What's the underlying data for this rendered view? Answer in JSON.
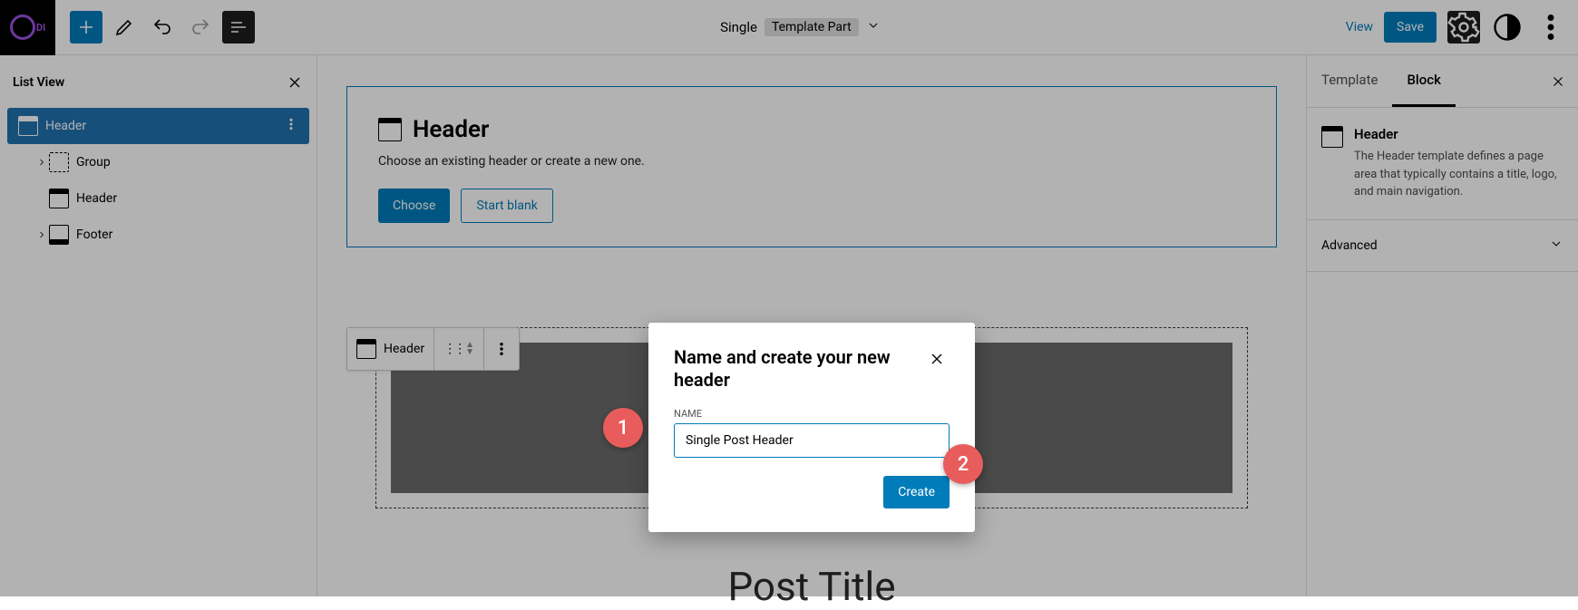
{
  "top": {
    "doc_title": "Single",
    "doc_subtitle": "Template Part",
    "view": "View",
    "save": "Save"
  },
  "list_view": {
    "title": "List View",
    "items": [
      {
        "label": "Header"
      },
      {
        "label": "Group"
      },
      {
        "label": "Header"
      },
      {
        "label": "Footer"
      }
    ]
  },
  "placeholder": {
    "title": "Header",
    "hint": "Choose an existing header or create a new one.",
    "choose": "Choose",
    "start_blank": "Start blank"
  },
  "block_toolbar": {
    "label": "Header"
  },
  "post_title": "Post Title",
  "inspector": {
    "tab_template": "Template",
    "tab_block": "Block",
    "block_title": "Header",
    "block_desc": "The Header template defines a page area that typically contains a title, logo, and main navigation.",
    "advanced": "Advanced"
  },
  "modal": {
    "title": "Name and create your new header",
    "name_label": "NAME",
    "name_value": "Single Post Header",
    "create": "Create"
  },
  "badges": {
    "b1": "1",
    "b2": "2"
  }
}
